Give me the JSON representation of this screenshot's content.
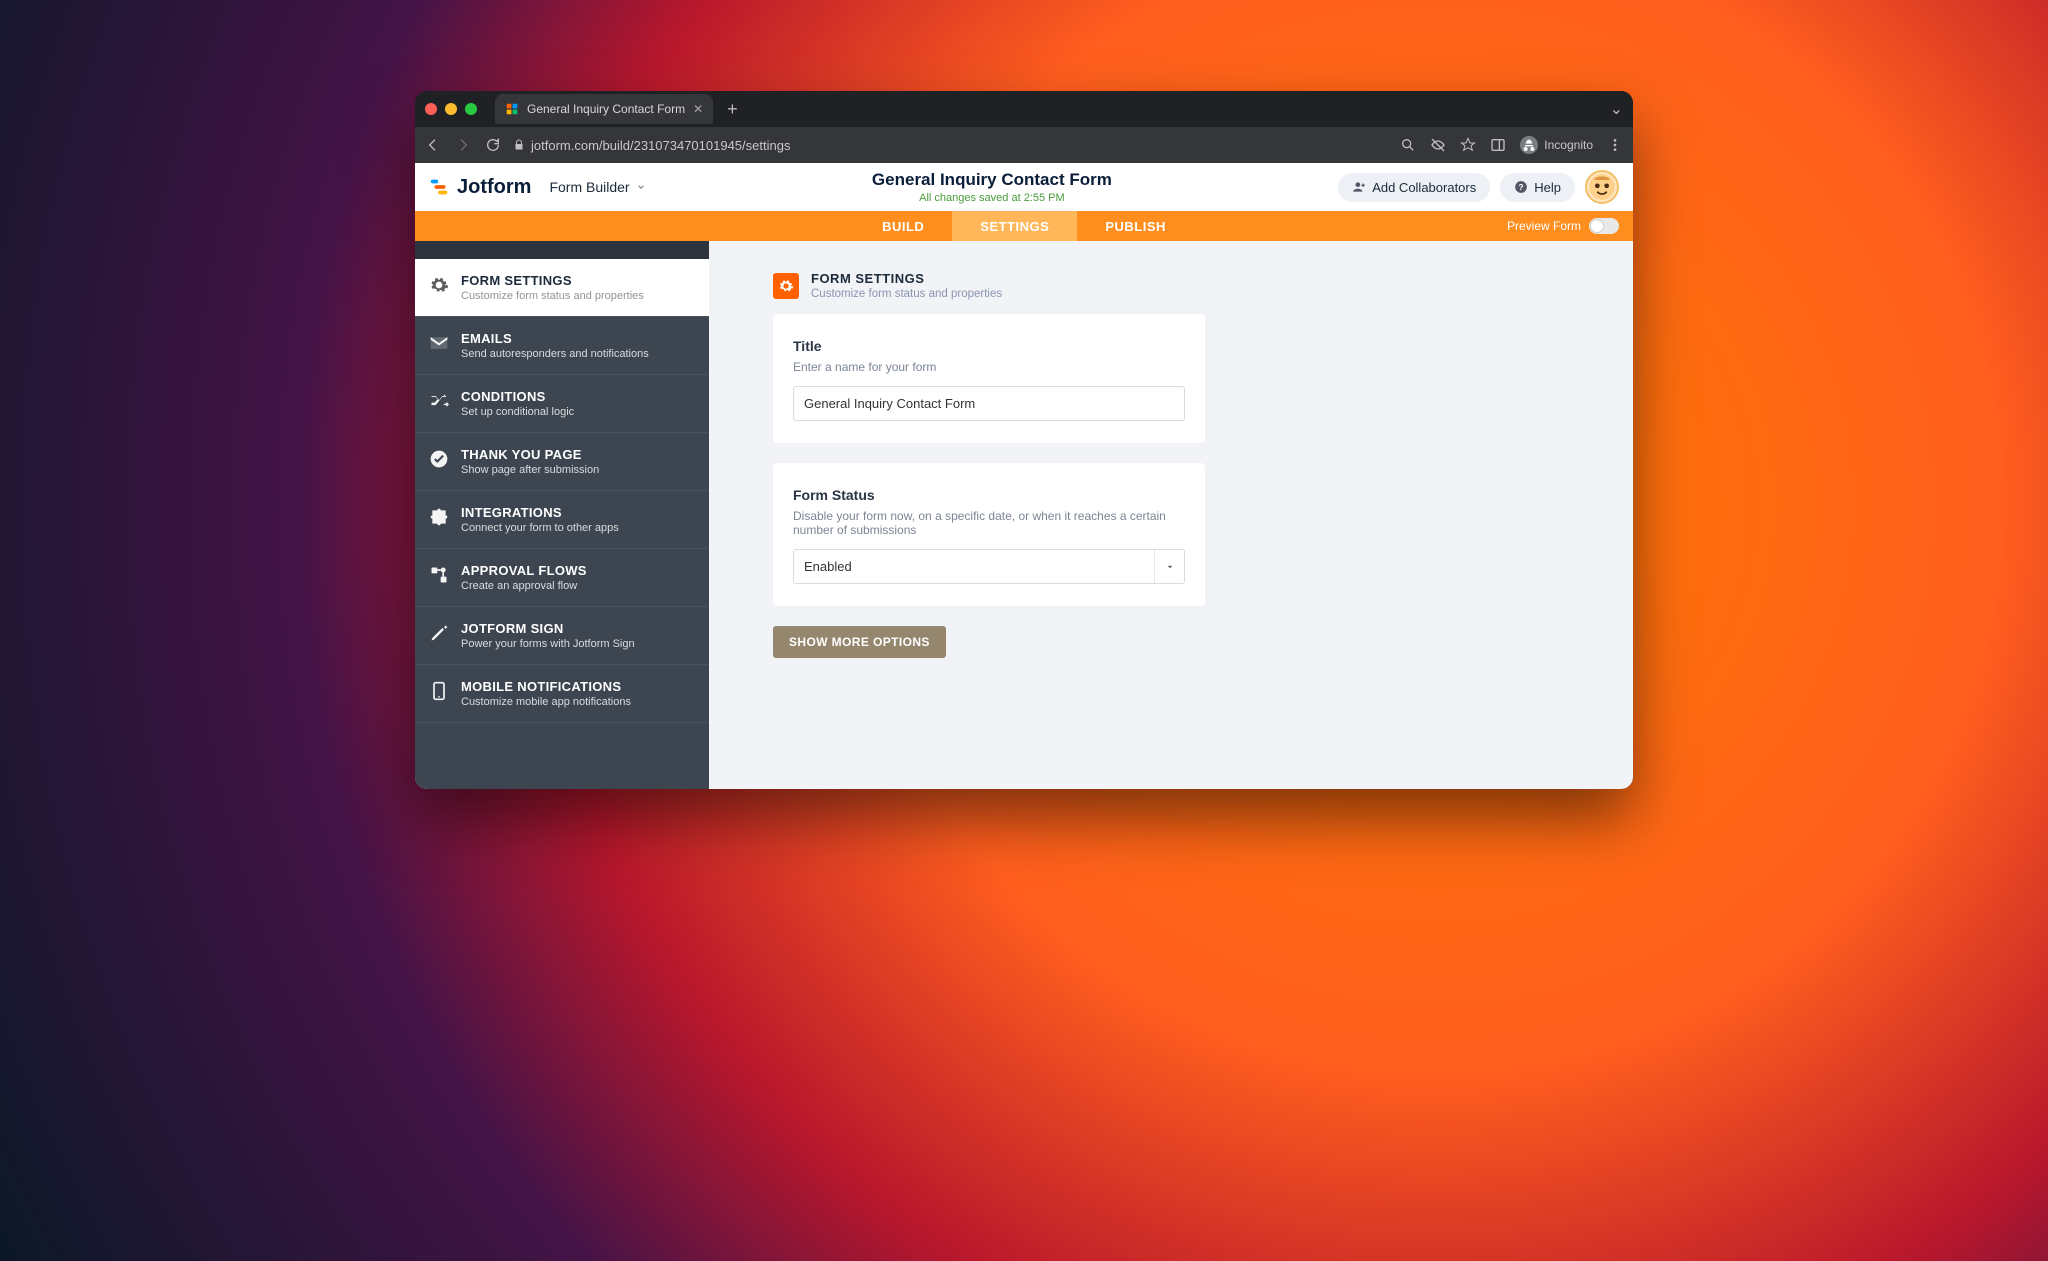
{
  "browser": {
    "tab_title": "General Inquiry Contact Form",
    "url": "jotform.com/build/231073470101945/settings",
    "incognito_label": "Incognito"
  },
  "header": {
    "logo_text": "Jotform",
    "form_builder_label": "Form Builder",
    "page_title": "General Inquiry Contact Form",
    "saved_text": "All changes saved at 2:55 PM",
    "add_collab": "Add Collaborators",
    "help": "Help"
  },
  "tabs": {
    "build": "BUILD",
    "settings": "SETTINGS",
    "publish": "PUBLISH",
    "preview": "Preview Form"
  },
  "sidebar": [
    {
      "title": "FORM SETTINGS",
      "desc": "Customize form status and properties"
    },
    {
      "title": "EMAILS",
      "desc": "Send autoresponders and notifications"
    },
    {
      "title": "CONDITIONS",
      "desc": "Set up conditional logic"
    },
    {
      "title": "THANK YOU PAGE",
      "desc": "Show page after submission"
    },
    {
      "title": "INTEGRATIONS",
      "desc": "Connect your form to other apps"
    },
    {
      "title": "APPROVAL FLOWS",
      "desc": "Create an approval flow"
    },
    {
      "title": "JOTFORM SIGN",
      "desc": "Power your forms with Jotform Sign"
    },
    {
      "title": "MOBILE NOTIFICATIONS",
      "desc": "Customize mobile app notifications"
    }
  ],
  "section": {
    "heading": "FORM SETTINGS",
    "subheading": "Customize form status and properties"
  },
  "title_field": {
    "label": "Title",
    "help": "Enter a name for your form",
    "value": "General Inquiry Contact Form"
  },
  "status_field": {
    "label": "Form Status",
    "help": "Disable your form now, on a specific date, or when it reaches a certain number of submissions",
    "value": "Enabled"
  },
  "more_button": "SHOW MORE OPTIONS"
}
